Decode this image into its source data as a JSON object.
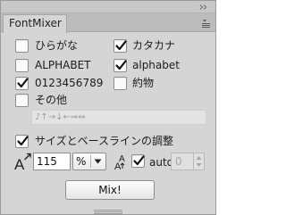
{
  "panel": {
    "tab_label": "FontMixer"
  },
  "options": {
    "hiragana": {
      "label": "ひらがな",
      "checked": false
    },
    "katakana": {
      "label": "カタカナ",
      "checked": true
    },
    "alphabet_upper": {
      "label": "ALPHABET",
      "checked": false
    },
    "alphabet_lower": {
      "label": "alphabet",
      "checked": true
    },
    "digits": {
      "label": "0123456789",
      "checked": true
    },
    "yakumono": {
      "label": "約物",
      "checked": false
    },
    "other": {
      "label": "その他",
      "checked": false,
      "field_value": "♪↑→↓←⇒⇔"
    }
  },
  "size_baseline": {
    "label": "サイズとベースラインの調整",
    "checked": true,
    "size_value": "115",
    "unit_value": "%",
    "auto_label": "auto",
    "auto_checked": true,
    "auto_value": "0",
    "icons": {
      "size": "font-size-icon",
      "auto": "baseline-shift-icon"
    }
  },
  "buttons": {
    "mix_label": "Mix!"
  }
}
